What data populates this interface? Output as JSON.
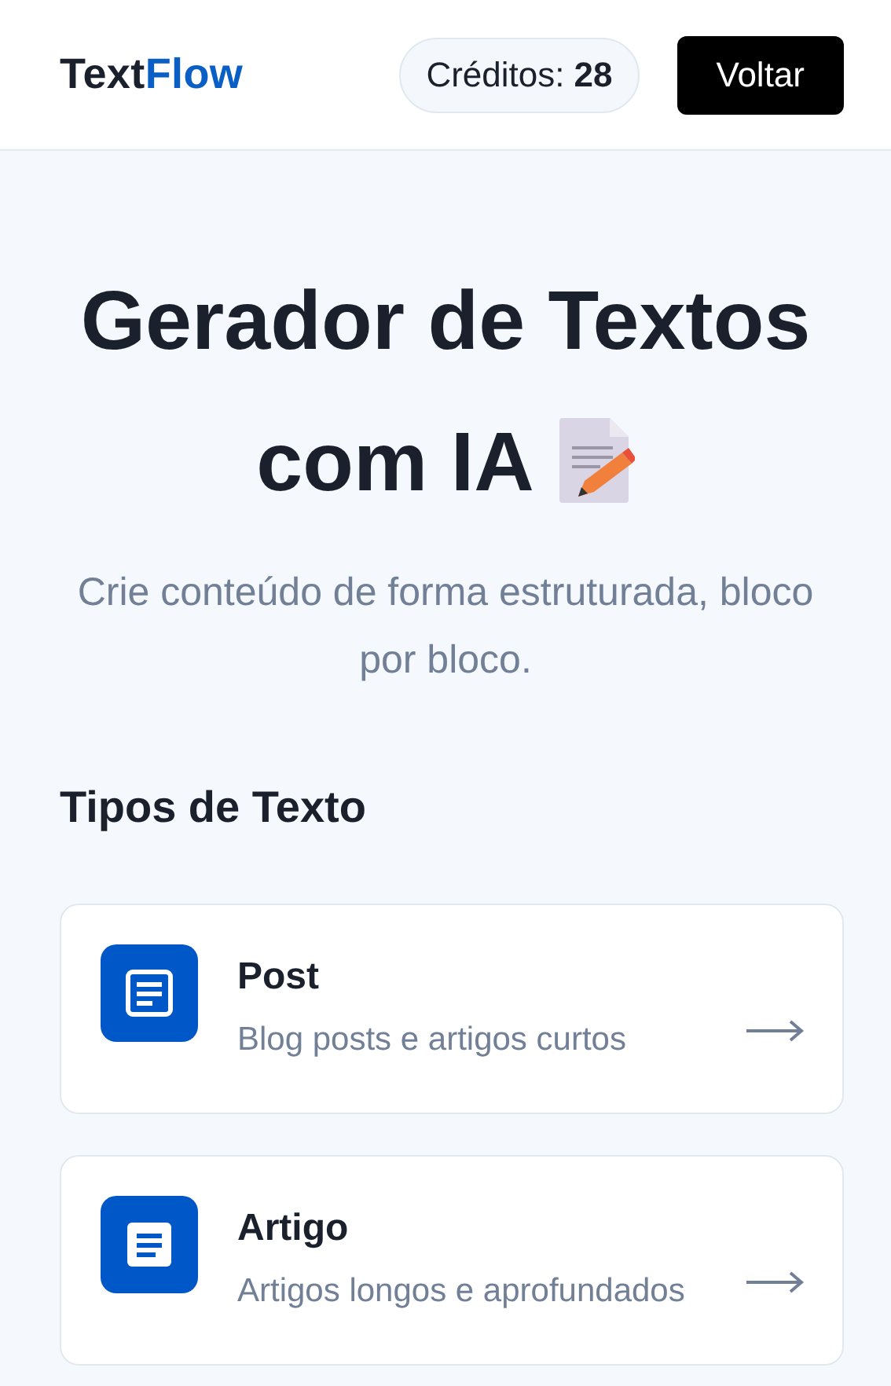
{
  "header": {
    "logo": {
      "dark": "Text",
      "accent": "Flow"
    },
    "credits": {
      "label": "Créditos:",
      "value": "28"
    },
    "back_button": "Voltar"
  },
  "hero": {
    "title": "Gerador de Textos com IA",
    "subtitle": "Crie conteúdo de forma estruturada, bloco por bloco."
  },
  "section_title": "Tipos de Texto",
  "types": [
    {
      "kind": "outline",
      "title": "Post",
      "description": "Blog posts e artigos curtos"
    },
    {
      "kind": "filled",
      "title": "Artigo",
      "description": "Artigos longos e aprofundados"
    }
  ]
}
